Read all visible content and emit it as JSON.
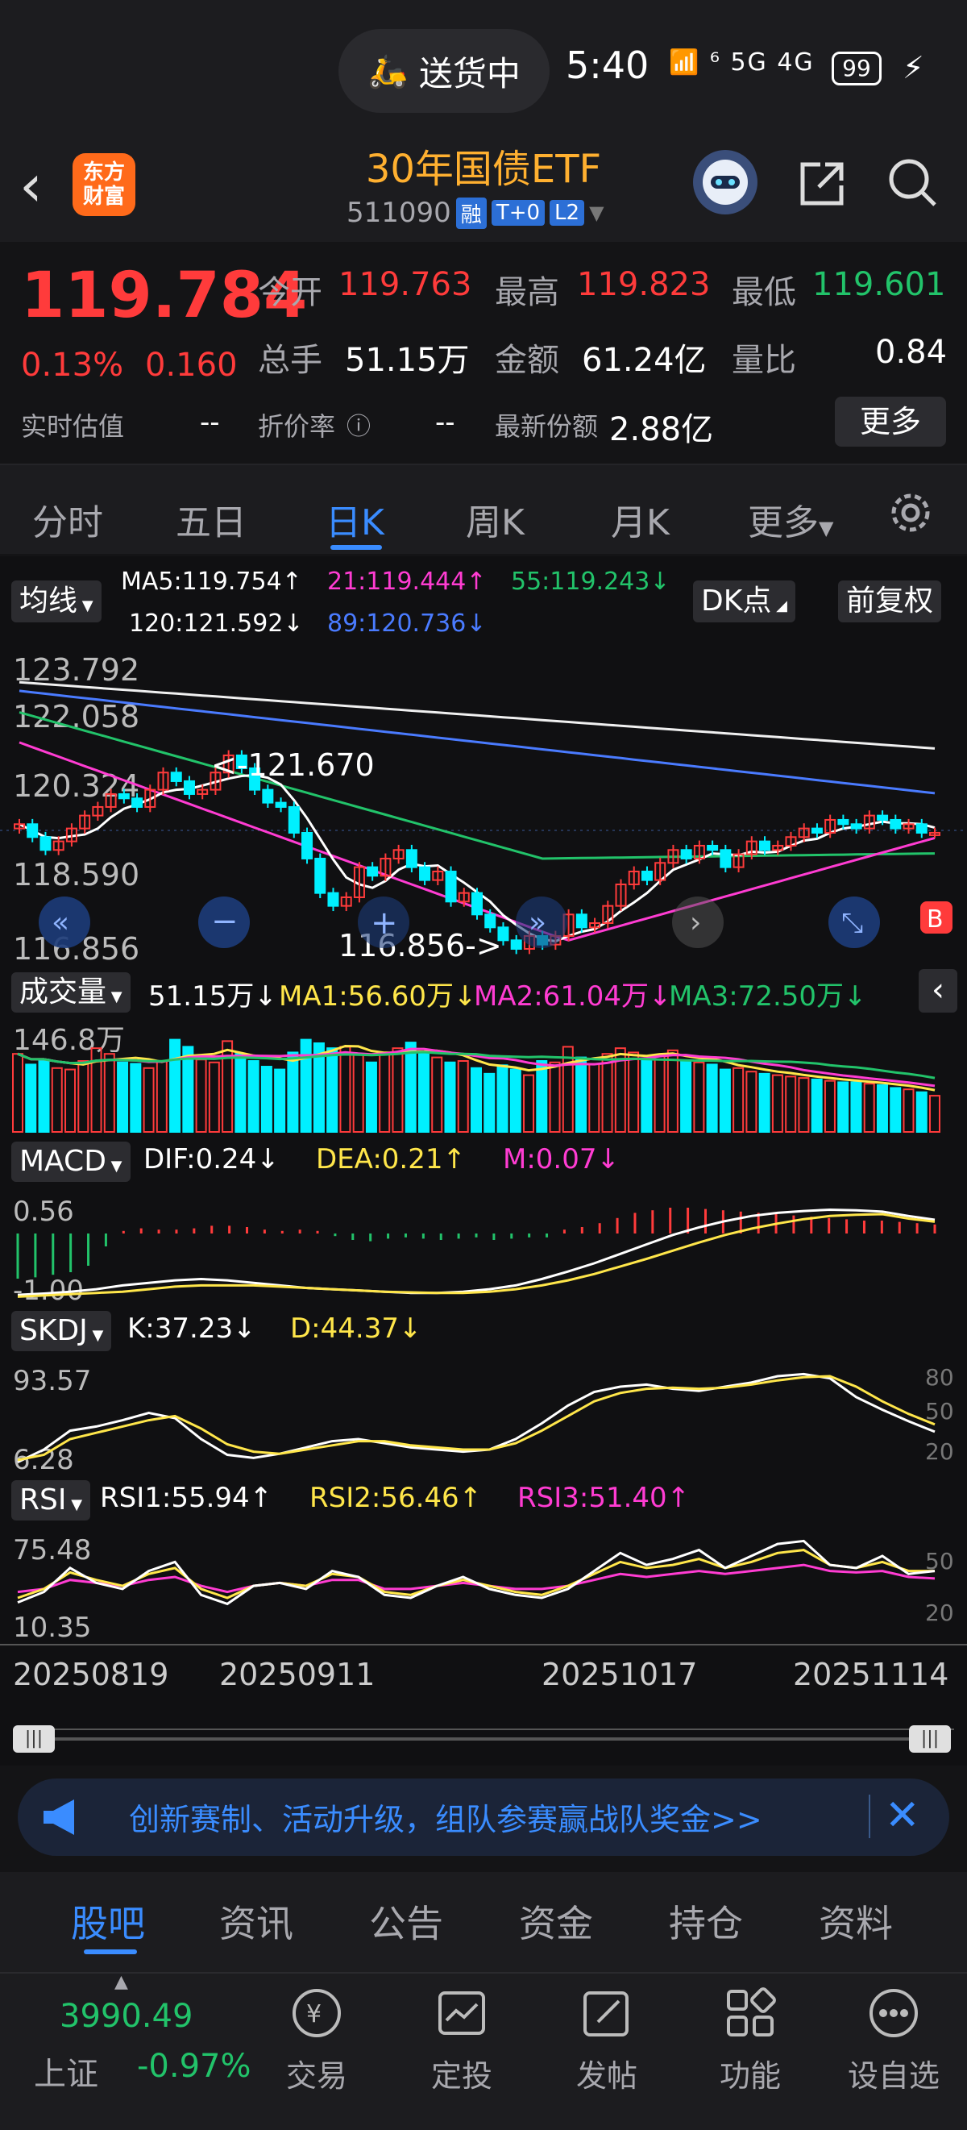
{
  "status_bar": {
    "delivery_label": "送货中",
    "time": "5:40",
    "network": "⁶ 5G 4G",
    "battery": "99"
  },
  "header": {
    "back": "‹",
    "logo": "东方\n财富",
    "title": "30年国债ETF",
    "code": "511090",
    "tags": [
      "融",
      "T+0",
      "L2"
    ]
  },
  "quote": {
    "price": "119.784",
    "pct": "0.13%",
    "change": "0.160",
    "open_label": "今开",
    "open": "119.763",
    "high_label": "最高",
    "high": "119.823",
    "low_label": "最低",
    "low": "119.601",
    "volume_label": "总手",
    "volume": "51.15万",
    "amount_label": "金额",
    "amount": "61.24亿",
    "ratio_label": "量比",
    "ratio": "0.84",
    "est_label": "实时估值",
    "est": "--",
    "discount_label": "折价率",
    "discount": "--",
    "shares_label": "最新份额",
    "shares": "2.88亿",
    "more": "更多"
  },
  "period_tabs": [
    "分时",
    "五日",
    "日K",
    "周K",
    "月K",
    "更多"
  ],
  "active_tab": "日K",
  "ma": {
    "selector": "均线",
    "ma5": "MA5:119.754↑",
    "ma21": "21:119.444↑",
    "ma55": "55:119.243↓",
    "ma120": "120:121.592↓",
    "ma89": "89:120.736↓",
    "dk": "DK点",
    "adjust": "前复权"
  },
  "kline_axis": {
    "y1": "123.792",
    "y2": "122.058",
    "y3": "120.324",
    "y4": "118.590",
    "y5": "116.856",
    "hi_note": "<-121.670",
    "lo_note": "116.856->"
  },
  "volume": {
    "selector": "成交量",
    "value": "51.15万↓",
    "ma1": "MA1:56.60万↓",
    "ma2": "MA2:61.04万↓",
    "ma3": "MA3:72.50万↓",
    "axis": "146.8万"
  },
  "macd": {
    "selector": "MACD",
    "dif": "DIF:0.24↓",
    "dea": "DEA:0.21↑",
    "m": "M:0.07↓",
    "y_top": "0.56",
    "y_bot": "-1.00"
  },
  "skdj": {
    "selector": "SKDJ",
    "k": "K:37.23↓",
    "d": "D:44.37↓",
    "y_top": "93.57",
    "y_bot": "6.28",
    "r80": "80",
    "r50": "50",
    "r20": "20"
  },
  "rsi": {
    "selector": "RSI",
    "rsi1": "RSI1:55.94↑",
    "rsi2": "RSI2:56.46↑",
    "rsi3": "RSI3:51.40↑",
    "y_top": "75.48",
    "y_bot": "10.35",
    "r50": "50",
    "r20": "20"
  },
  "dates": [
    "20250819",
    "20250911",
    "20251017",
    "20251114"
  ],
  "colors": {
    "up": "#ff3b3b",
    "down": "#00f0ff",
    "ma5": "#ffffff",
    "ma21": "#ff3cd2",
    "ma55": "#22c36a",
    "ma89": "#4a7bff",
    "ma120": "#f0f0f0",
    "accent": "#3a8cff"
  },
  "banner": {
    "text": "创新赛制、活动升级，组队参赛赢战队奖金>>"
  },
  "info_tabs": [
    "股吧",
    "资讯",
    "公告",
    "资金",
    "持仓",
    "资料"
  ],
  "index": {
    "value": "3990.49",
    "name": "上证",
    "pct": "-0.97%"
  },
  "bottom_nav": [
    "交易",
    "定投",
    "发帖",
    "功能",
    "设自选"
  ],
  "chart_data": {
    "type": "candlestick",
    "title": "30年国债ETF 511090 日K",
    "y_range": [
      116.856,
      123.792
    ],
    "x_labels": [
      "20250819",
      "20250911",
      "20251017",
      "20251114"
    ],
    "high_mark": 121.67,
    "low_mark": 116.856,
    "close": [
      120.0,
      119.7,
      119.4,
      119.6,
      119.9,
      120.2,
      120.4,
      120.7,
      120.6,
      120.4,
      120.8,
      121.2,
      121.0,
      120.7,
      120.8,
      121.2,
      121.6,
      121.3,
      120.8,
      120.5,
      120.4,
      119.8,
      119.2,
      118.4,
      118.1,
      118.3,
      119.0,
      118.8,
      119.2,
      119.4,
      119.0,
      118.7,
      118.9,
      118.2,
      118.4,
      117.9,
      117.6,
      117.3,
      117.1,
      117.4,
      117.2,
      117.4,
      117.9,
      117.6,
      117.7,
      118.1,
      118.6,
      118.9,
      118.7,
      119.1,
      119.4,
      119.2,
      119.5,
      119.4,
      119.0,
      119.3,
      119.6,
      119.4,
      119.5,
      119.7,
      119.9,
      119.8,
      120.1,
      120.0,
      119.9,
      120.2,
      120.1,
      119.9,
      120.0,
      119.8,
      119.8
    ],
    "volume_wan": [
      110,
      95,
      102,
      90,
      88,
      100,
      118,
      110,
      98,
      96,
      90,
      100,
      130,
      120,
      102,
      98,
      128,
      110,
      100,
      92,
      88,
      112,
      130,
      125,
      118,
      120,
      110,
      98,
      112,
      118,
      126,
      112,
      105,
      98,
      100,
      90,
      82,
      94,
      88,
      80,
      100,
      98,
      120,
      105,
      96,
      110,
      118,
      112,
      100,
      108,
      115,
      100,
      98,
      95,
      88,
      90,
      85,
      82,
      80,
      78,
      76,
      74,
      72,
      70,
      70,
      68,
      66,
      62,
      60,
      56,
      51
    ],
    "macd_hist": [
      -0.35,
      -0.34,
      -0.32,
      -0.3,
      -0.25,
      -0.1,
      0.02,
      0.04,
      0.03,
      0.03,
      0.04,
      0.06,
      0.06,
      0.05,
      0.03,
      0.02,
      0.03,
      0.02,
      -0.02,
      -0.05,
      -0.06,
      -0.04,
      -0.03,
      -0.04,
      -0.05,
      -0.04,
      -0.03,
      -0.05,
      -0.04,
      -0.03,
      -0.03,
      0.03,
      0.05,
      0.08,
      0.12,
      0.16,
      0.18,
      0.2,
      0.2,
      0.19,
      0.18,
      0.17,
      0.16,
      0.15,
      0.14,
      0.13,
      0.12,
      0.11,
      0.1,
      0.1,
      0.09,
      0.08,
      0.07
    ],
    "macd_dif": [
      -0.95,
      -0.93,
      -0.9,
      -0.86,
      -0.8,
      -0.76,
      -0.72,
      -0.7,
      -0.72,
      -0.76,
      -0.8,
      -0.84,
      -0.86,
      -0.88,
      -0.9,
      -0.92,
      -0.92,
      -0.9,
      -0.86,
      -0.8,
      -0.7,
      -0.58,
      -0.45,
      -0.3,
      -0.15,
      0.0,
      0.12,
      0.22,
      0.3,
      0.35,
      0.38,
      0.4,
      0.39,
      0.37,
      0.3,
      0.24
    ],
    "macd_dea": [
      -0.98,
      -0.96,
      -0.94,
      -0.92,
      -0.9,
      -0.86,
      -0.82,
      -0.8,
      -0.8,
      -0.8,
      -0.82,
      -0.84,
      -0.86,
      -0.88,
      -0.9,
      -0.91,
      -0.92,
      -0.92,
      -0.9,
      -0.86,
      -0.8,
      -0.72,
      -0.62,
      -0.5,
      -0.38,
      -0.25,
      -0.12,
      0.0,
      0.1,
      0.18,
      0.25,
      0.3,
      0.32,
      0.33,
      0.26,
      0.21
    ],
    "skdj_k": [
      8,
      20,
      38,
      42,
      48,
      55,
      50,
      30,
      15,
      12,
      16,
      22,
      28,
      30,
      26,
      22,
      20,
      18,
      20,
      30,
      45,
      62,
      75,
      80,
      82,
      78,
      76,
      80,
      84,
      90,
      92,
      88,
      70,
      58,
      47,
      37
    ],
    "skdj_d": [
      10,
      15,
      30,
      36,
      42,
      48,
      52,
      40,
      25,
      18,
      16,
      20,
      24,
      28,
      28,
      24,
      22,
      20,
      20,
      26,
      38,
      52,
      66,
      74,
      78,
      79,
      78,
      79,
      82,
      86,
      89,
      90,
      80,
      66,
      54,
      44
    ],
    "rsi1": [
      35,
      42,
      58,
      48,
      44,
      56,
      62,
      40,
      34,
      46,
      48,
      44,
      56,
      52,
      40,
      38,
      46,
      52,
      44,
      40,
      38,
      44,
      56,
      68,
      60,
      64,
      70,
      58,
      66,
      74,
      76,
      60,
      58,
      66,
      54,
      56
    ],
    "rsi2": [
      38,
      44,
      55,
      50,
      46,
      54,
      58,
      44,
      38,
      46,
      48,
      46,
      54,
      52,
      42,
      40,
      46,
      50,
      46,
      42,
      40,
      46,
      54,
      62,
      58,
      60,
      64,
      58,
      62,
      68,
      70,
      60,
      58,
      62,
      56,
      56
    ],
    "rsi3": [
      42,
      44,
      50,
      48,
      46,
      50,
      52,
      46,
      42,
      46,
      48,
      46,
      50,
      50,
      44,
      44,
      46,
      48,
      46,
      44,
      44,
      46,
      50,
      54,
      52,
      54,
      56,
      54,
      56,
      58,
      60,
      56,
      55,
      56,
      52,
      51
    ]
  }
}
